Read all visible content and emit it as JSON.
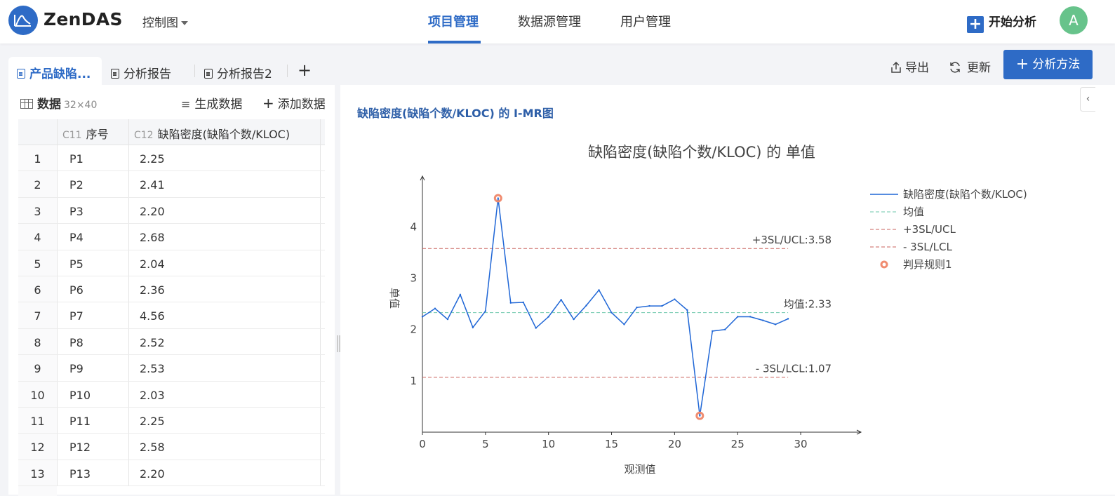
{
  "topnav": {
    "brand": "ZenDAS",
    "chart_menu": "控制图",
    "tabs": [
      "项目管理",
      "数据源管理",
      "用户管理"
    ],
    "active_tab": 0,
    "start_label": "开始分析",
    "avatar_letter": "A",
    "accent_color": "#2e6bc6"
  },
  "doc_tabs": [
    {
      "label": "产品缺陷..."
    },
    {
      "label": "分析报告"
    },
    {
      "label": "分析报告2"
    }
  ],
  "actions": {
    "export": "导出",
    "refresh": "更新",
    "method": "分析方法"
  },
  "data_panel": {
    "title": "数据",
    "dims": "32×40",
    "generate": "生成数据",
    "add": "添加数据",
    "columns": [
      {
        "id": "C11",
        "name": "序号"
      },
      {
        "id": "C12",
        "name": "缺陷密度(缺陷个数/KLOC)"
      }
    ],
    "rows": [
      {
        "idx": "1",
        "c1": "P1",
        "c2": "2.25"
      },
      {
        "idx": "2",
        "c1": "P2",
        "c2": "2.41"
      },
      {
        "idx": "3",
        "c1": "P3",
        "c2": "2.20"
      },
      {
        "idx": "4",
        "c1": "P4",
        "c2": "2.68"
      },
      {
        "idx": "5",
        "c1": "P5",
        "c2": "2.04"
      },
      {
        "idx": "6",
        "c1": "P6",
        "c2": "2.36"
      },
      {
        "idx": "7",
        "c1": "P7",
        "c2": "4.56"
      },
      {
        "idx": "8",
        "c1": "P8",
        "c2": "2.52"
      },
      {
        "idx": "9",
        "c1": "P9",
        "c2": "2.53"
      },
      {
        "idx": "10",
        "c1": "P10",
        "c2": "2.03"
      },
      {
        "idx": "11",
        "c1": "P11",
        "c2": "2.25"
      },
      {
        "idx": "12",
        "c1": "P12",
        "c2": "2.58"
      },
      {
        "idx": "13",
        "c1": "P13",
        "c2": "2.20"
      }
    ]
  },
  "chart_panel": {
    "title": "缺陷密度(缺陷个数/KLOC) 的 I-MR图",
    "collapse_icon": "‹"
  },
  "chart_data": {
    "type": "line",
    "title": "缺陷密度(缺陷个数/KLOC) 的 单值",
    "xlabel": "观测值",
    "ylabel": "单值",
    "xlim": [
      0,
      32
    ],
    "ylim": [
      0,
      4.95
    ],
    "xticks": [
      0,
      5,
      10,
      15,
      20,
      25,
      30
    ],
    "yticks": [
      1,
      2,
      3,
      4
    ],
    "series": [
      {
        "name": "缺陷密度(缺陷个数/KLOC)",
        "color": "#1f66d6",
        "x": [
          0,
          1,
          2,
          3,
          4,
          5,
          6,
          7,
          8,
          9,
          10,
          11,
          12,
          13,
          14,
          15,
          16,
          17,
          18,
          19,
          20,
          21,
          22,
          23,
          24,
          25,
          26,
          27,
          28,
          29
        ],
        "y": [
          2.25,
          2.41,
          2.2,
          2.68,
          2.04,
          2.36,
          4.56,
          2.52,
          2.53,
          2.03,
          2.25,
          2.58,
          2.2,
          2.47,
          2.77,
          2.33,
          2.1,
          2.43,
          2.46,
          2.46,
          2.59,
          2.38,
          0.32,
          1.97,
          2.0,
          2.25,
          2.25,
          2.18,
          2.1,
          2.21
        ]
      }
    ],
    "lines": [
      {
        "name": "均值",
        "value": 2.33,
        "label": "均值:2.33",
        "color": "#6cc7ab"
      },
      {
        "name": "+3SL/UCL",
        "value": 3.58,
        "label": "+3SL/UCL:3.58",
        "color": "#c9605c"
      },
      {
        "name": "- 3SL/LCL",
        "value": 1.07,
        "label": "- 3SL/LCL:1.07",
        "color": "#c9605c"
      }
    ],
    "rule": {
      "name": "判异规则1",
      "points": [
        6,
        22
      ],
      "color": "#f08c70"
    },
    "legend_position": "right",
    "grid": false
  }
}
